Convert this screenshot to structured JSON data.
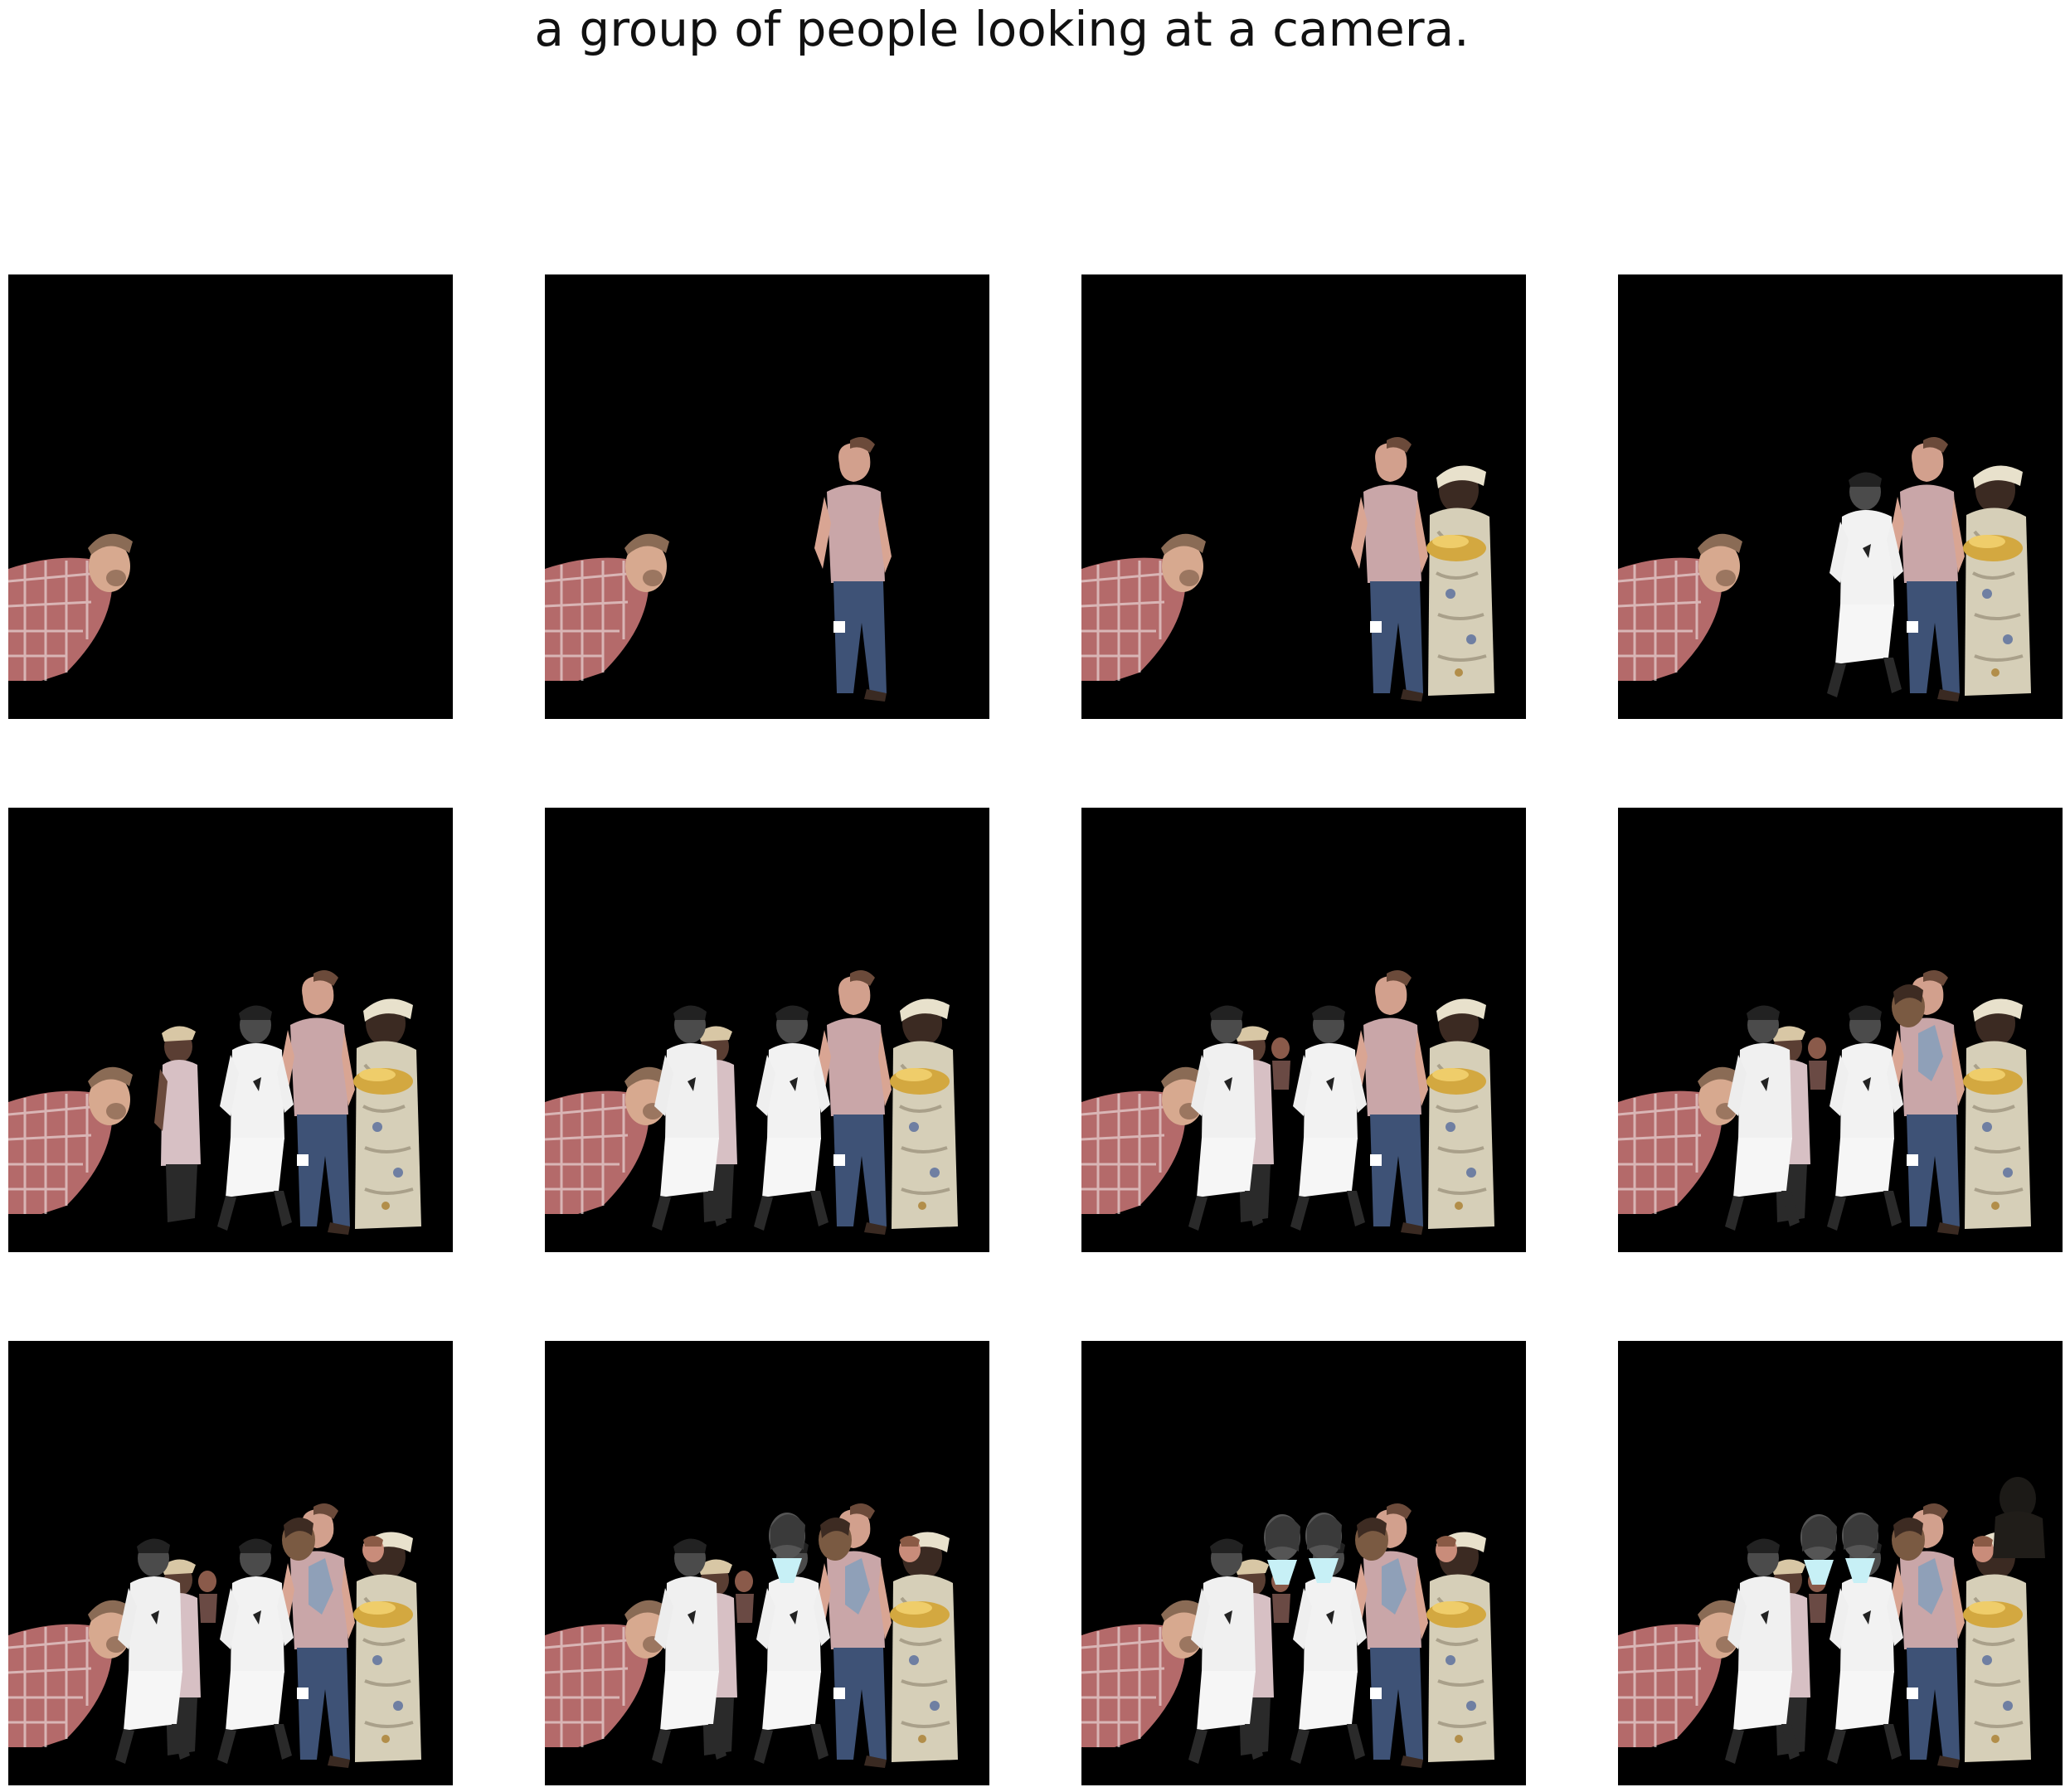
{
  "title": "a group of people looking at a camera.",
  "figure": {
    "rows": 3,
    "cols": 4,
    "panel_background": "#000000",
    "page_background": "#ffffff",
    "description_step": "Each panel adds one more cut-out figure to a black canvas, building a group composition left to right."
  },
  "panels": [
    {
      "figures": [
        "man-checked-shirt"
      ]
    },
    {
      "figures": [
        "man-checked-shirt",
        "man-grey-tshirt"
      ]
    },
    {
      "figures": [
        "man-checked-shirt",
        "man-grey-tshirt",
        "woman-patterned-dress"
      ]
    },
    {
      "figures": [
        "man-checked-shirt",
        "man-grey-tshirt",
        "woman-patterned-dress",
        "baseball-player-1"
      ]
    },
    {
      "figures": [
        "man-checked-shirt",
        "man-grey-tshirt",
        "woman-patterned-dress",
        "baseball-player-1",
        "man-cap"
      ]
    },
    {
      "figures": [
        "man-checked-shirt",
        "man-grey-tshirt",
        "woman-patterned-dress",
        "baseball-player-1",
        "man-cap",
        "baseball-player-2"
      ]
    },
    {
      "figures": [
        "man-checked-shirt",
        "man-grey-tshirt",
        "woman-patterned-dress",
        "baseball-player-1",
        "man-cap",
        "baseball-player-2",
        "small-head"
      ]
    },
    {
      "figures": [
        "man-checked-shirt",
        "man-grey-tshirt",
        "woman-patterned-dress",
        "baseball-player-1",
        "man-cap",
        "baseball-player-2",
        "small-head",
        "man-back-head"
      ]
    },
    {
      "figures": [
        "man-checked-shirt",
        "man-grey-tshirt",
        "woman-patterned-dress",
        "baseball-player-1",
        "man-cap",
        "baseball-player-2",
        "small-head",
        "man-back-head",
        "small-head-2"
      ]
    },
    {
      "figures": [
        "man-checked-shirt",
        "man-grey-tshirt",
        "woman-patterned-dress",
        "baseball-player-1",
        "man-cap",
        "baseball-player-2",
        "small-head",
        "man-back-head",
        "small-head-2",
        "grey-hair-head"
      ]
    },
    {
      "figures": [
        "man-checked-shirt",
        "man-grey-tshirt",
        "woman-patterned-dress",
        "baseball-player-1",
        "man-cap",
        "baseball-player-2",
        "small-head",
        "man-back-head",
        "small-head-2",
        "grey-hair-head",
        "grey-hair-head-2"
      ]
    },
    {
      "figures": [
        "man-checked-shirt",
        "man-grey-tshirt",
        "woman-patterned-dress",
        "baseball-player-1",
        "man-cap",
        "baseball-player-2",
        "small-head",
        "man-back-head",
        "small-head-2",
        "grey-hair-head",
        "grey-hair-head-2",
        "dark-silhouette"
      ]
    }
  ]
}
